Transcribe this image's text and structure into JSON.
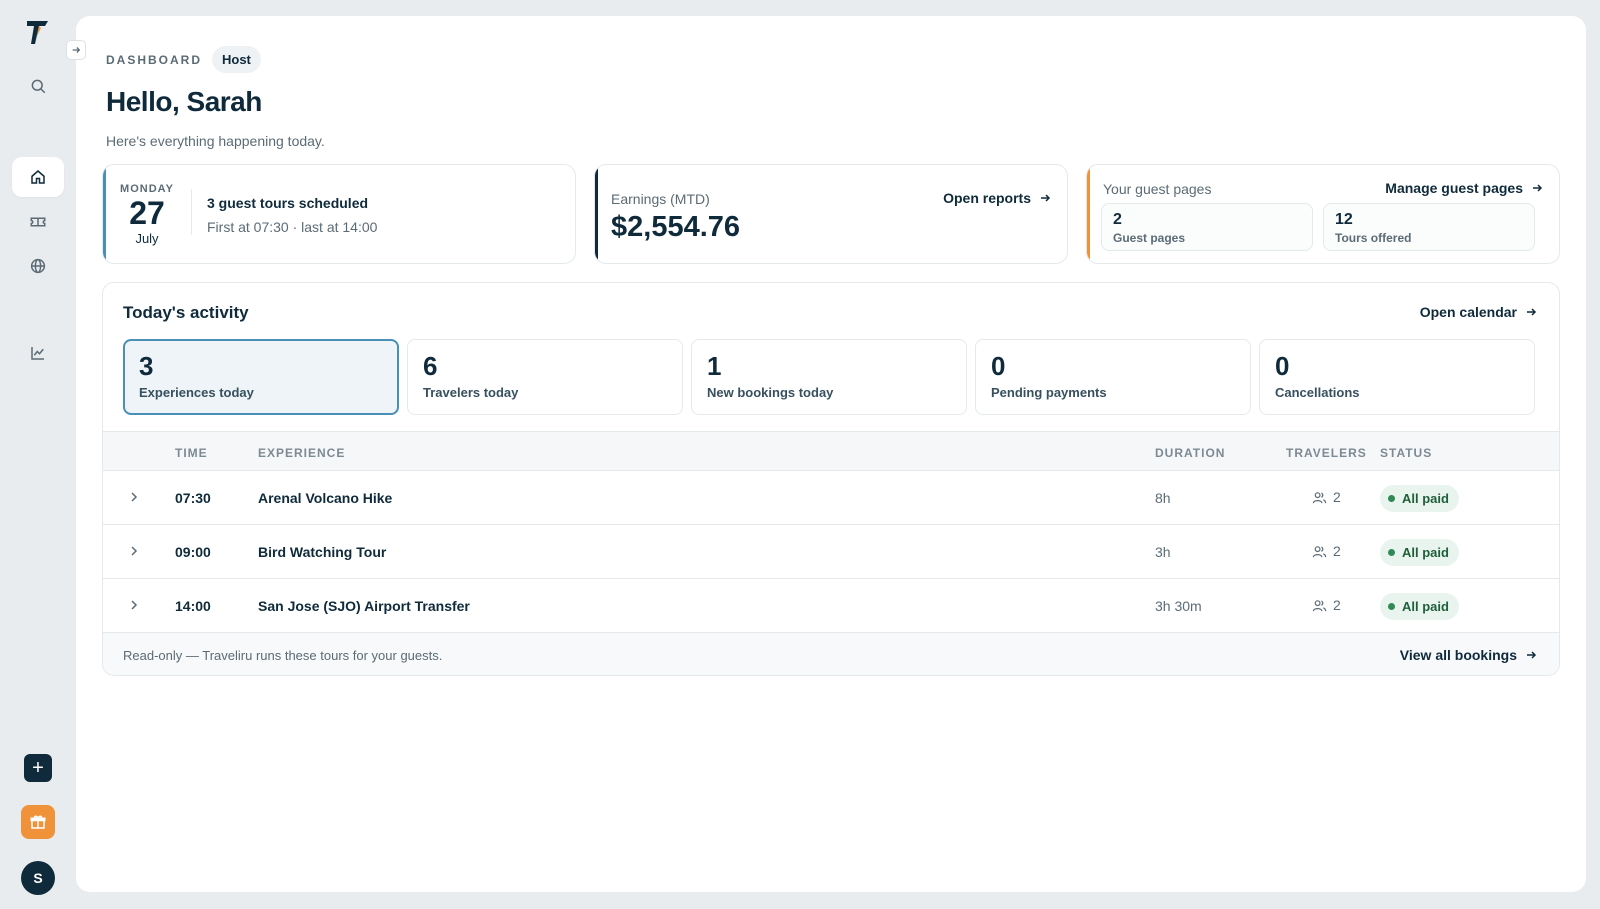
{
  "sidebar": {
    "items": [
      {
        "icon": "search-icon"
      },
      {
        "icon": "home-icon",
        "active": true
      },
      {
        "icon": "ticket-icon"
      },
      {
        "icon": "globe-icon"
      },
      {
        "icon": "chart-icon"
      }
    ],
    "add_label": "+",
    "avatar_initial": "S"
  },
  "header": {
    "breadcrumb": "DASHBOARD",
    "role_badge": "Host",
    "title": "Hello, Sarah",
    "subtitle": "Here's everything happening today."
  },
  "date_card": {
    "weekday": "MONDAY",
    "day": "27",
    "month": "July",
    "summary": "3 guest tours scheduled",
    "detail": "First at 07:30 · last at 14:00",
    "accent": "#4a8fb5"
  },
  "earnings_card": {
    "label": "Earnings (MTD)",
    "value": "$2,554.76",
    "link": "Open reports",
    "accent": "#0f2a3a"
  },
  "guest_card": {
    "label": "Your guest pages",
    "link": "Manage guest pages",
    "accent": "#f0923a",
    "stats": [
      {
        "value": "2",
        "label": "Guest pages"
      },
      {
        "value": "12",
        "label": "Tours offered"
      }
    ]
  },
  "activity": {
    "title": "Today's activity",
    "link": "Open calendar",
    "tiles": [
      {
        "value": "3",
        "label": "Experiences today",
        "active": true
      },
      {
        "value": "6",
        "label": "Travelers today"
      },
      {
        "value": "1",
        "label": "New bookings today"
      },
      {
        "value": "0",
        "label": "Pending payments"
      },
      {
        "value": "0",
        "label": "Cancellations"
      }
    ],
    "columns": {
      "time": "TIME",
      "experience": "EXPERIENCE",
      "duration": "DURATION",
      "travelers": "TRAVELERS",
      "status": "STATUS"
    },
    "rows": [
      {
        "time": "07:30",
        "experience": "Arenal Volcano Hike",
        "duration": "8h",
        "travelers": "2",
        "status": "All paid"
      },
      {
        "time": "09:00",
        "experience": "Bird Watching Tour",
        "duration": "3h",
        "travelers": "2",
        "status": "All paid"
      },
      {
        "time": "14:00",
        "experience": "San Jose (SJO) Airport Transfer",
        "duration": "3h 30m",
        "travelers": "2",
        "status": "All paid"
      }
    ],
    "footer_note": "Read-only — Traveliru runs these tours for your guests.",
    "footer_link": "View all bookings"
  }
}
